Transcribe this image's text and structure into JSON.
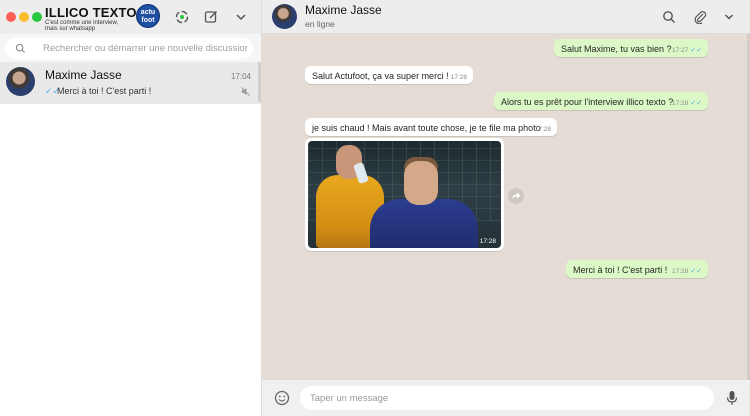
{
  "app": {
    "title": "ILLICO TEXTO",
    "subtitle": "C'est comme une interview, mais sur whatsapp",
    "brand_logo_text": "actu foot"
  },
  "colors": {
    "outgoing_bubble": "#dcf8c6",
    "incoming_bubble": "#ffffff",
    "chat_background": "#e5ddd5",
    "read_tick": "#4fb6ec"
  },
  "icons": {
    "status": "status-icon",
    "compose": "compose-icon",
    "menu": "chevron-down-icon",
    "search": "search-icon",
    "attach": "paperclip-icon",
    "emoji": "emoji-icon",
    "mic": "mic-icon",
    "mute": "mute-icon",
    "forward": "forward-icon"
  },
  "search": {
    "placeholder": "Rechercher ou démarrer une nouvelle discussion"
  },
  "chat_list": [
    {
      "name": "Maxime Jasse",
      "time": "17:04",
      "ticks": "✓✓",
      "preview": "Merci à toi ! C'est parti !"
    }
  ],
  "conversation": {
    "contact_name": "Maxime Jasse",
    "contact_status": "en ligne",
    "messages": [
      {
        "direction": "out",
        "text": "Salut Maxime, tu vas bien ?",
        "time": "17:27",
        "ticks": "✓✓"
      },
      {
        "direction": "in",
        "text": "Salut Actufoot, ça va super merci !",
        "time": "17:28"
      },
      {
        "direction": "out",
        "text": "Alors tu es prêt pour l'interview illico texto ?",
        "time": "17:28",
        "ticks": "✓✓"
      },
      {
        "direction": "in",
        "text": "je suis chaud ! Mais avant toute chose, je te file ma photo",
        "time": "17:28"
      },
      {
        "direction": "in",
        "type": "photo",
        "time": "17:28"
      },
      {
        "direction": "out",
        "text": "Merci à toi ! C'est parti !",
        "time": "17:28",
        "ticks": "✓✓"
      }
    ]
  },
  "composer": {
    "placeholder": "Taper un message"
  }
}
